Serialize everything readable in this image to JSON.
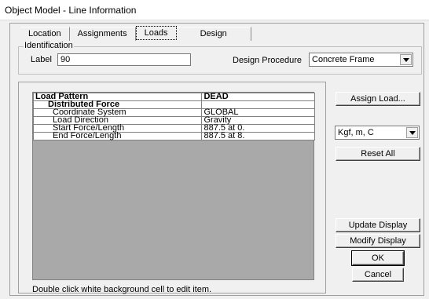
{
  "window": {
    "title": "Object Model - Line Information"
  },
  "tabs": [
    {
      "label": "Location"
    },
    {
      "label": "Assignments"
    },
    {
      "label": "Loads",
      "active": true
    },
    {
      "label": "Design"
    }
  ],
  "identification": {
    "legend": "Identification",
    "label_caption": "Label",
    "label_value": "90",
    "design_procedure_caption": "Design Procedure",
    "design_procedure_value": "Concrete Frame"
  },
  "grid": {
    "rows": [
      {
        "name": "Load Pattern",
        "value": "DEAD"
      },
      {
        "name": "Distributed Force",
        "value": ""
      },
      {
        "name": "Coordinate System",
        "value": "GLOBAL"
      },
      {
        "name": "Load Direction",
        "value": "Gravity"
      },
      {
        "name": "Start Force/Length",
        "value": "887.5 at 0."
      },
      {
        "name": "End Force/Length",
        "value": "887.5 at 8."
      }
    ]
  },
  "status_text": "Double click white background cell to edit item.",
  "buttons": {
    "assign_load": "Assign Load...",
    "units_value": "Kgf, m, C",
    "reset_all": "Reset All",
    "update_display": "Update Display",
    "modify_display": "Modify Display",
    "ok": "OK",
    "cancel": "Cancel"
  }
}
